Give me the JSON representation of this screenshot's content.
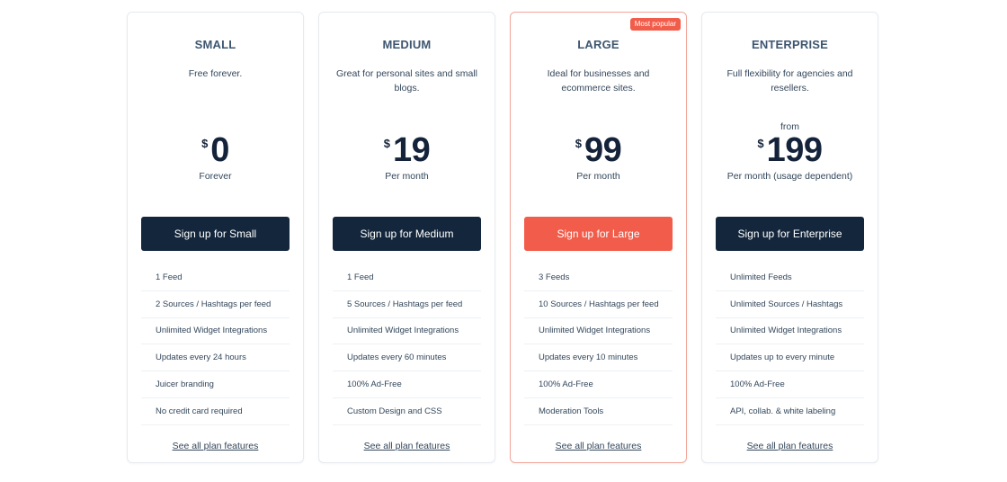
{
  "colors": {
    "dark_button": "#13263b",
    "accent": "#f25c4a",
    "heading": "#3e5670",
    "price": "#14233a"
  },
  "plans": [
    {
      "name": "SMALL",
      "description": "Free forever.",
      "price_prefix": "",
      "currency": "$",
      "amount": "0",
      "period": "Forever",
      "cta": "Sign up for Small",
      "features": [
        "1 Feed",
        "2 Sources / Hashtags per feed",
        "Unlimited Widget Integrations",
        "Updates every 24 hours",
        "Juicer branding",
        "No credit card required"
      ],
      "more_link": "See all plan features"
    },
    {
      "name": "MEDIUM",
      "description": "Great for personal sites and small blogs.",
      "price_prefix": "",
      "currency": "$",
      "amount": "19",
      "period": "Per month",
      "cta": "Sign up for Medium",
      "features": [
        "1 Feed",
        "5 Sources / Hashtags per feed",
        "Unlimited Widget Integrations",
        "Updates every 60 minutes",
        "100% Ad-Free",
        "Custom Design and CSS"
      ],
      "more_link": "See all plan features"
    },
    {
      "name": "LARGE",
      "badge": "Most popular",
      "description": "Ideal for businesses and ecommerce sites.",
      "price_prefix": "",
      "currency": "$",
      "amount": "99",
      "period": "Per month",
      "cta": "Sign up for Large",
      "features": [
        "3 Feeds",
        "10 Sources / Hashtags per feed",
        "Unlimited Widget Integrations",
        "Updates every 10 minutes",
        "100% Ad-Free",
        "Moderation Tools"
      ],
      "more_link": "See all plan features"
    },
    {
      "name": "ENTERPRISE",
      "description": "Full flexibility for agencies and resellers.",
      "price_prefix": "from",
      "currency": "$",
      "amount": "199",
      "period": "Per month (usage dependent)",
      "cta": "Sign up for Enterprise",
      "features": [
        "Unlimited Feeds",
        "Unlimited Sources / Hashtags",
        "Unlimited Widget Integrations",
        "Updates up to every minute",
        "100% Ad-Free",
        "API, collab. & white labeling"
      ],
      "more_link": "See all plan features"
    }
  ]
}
